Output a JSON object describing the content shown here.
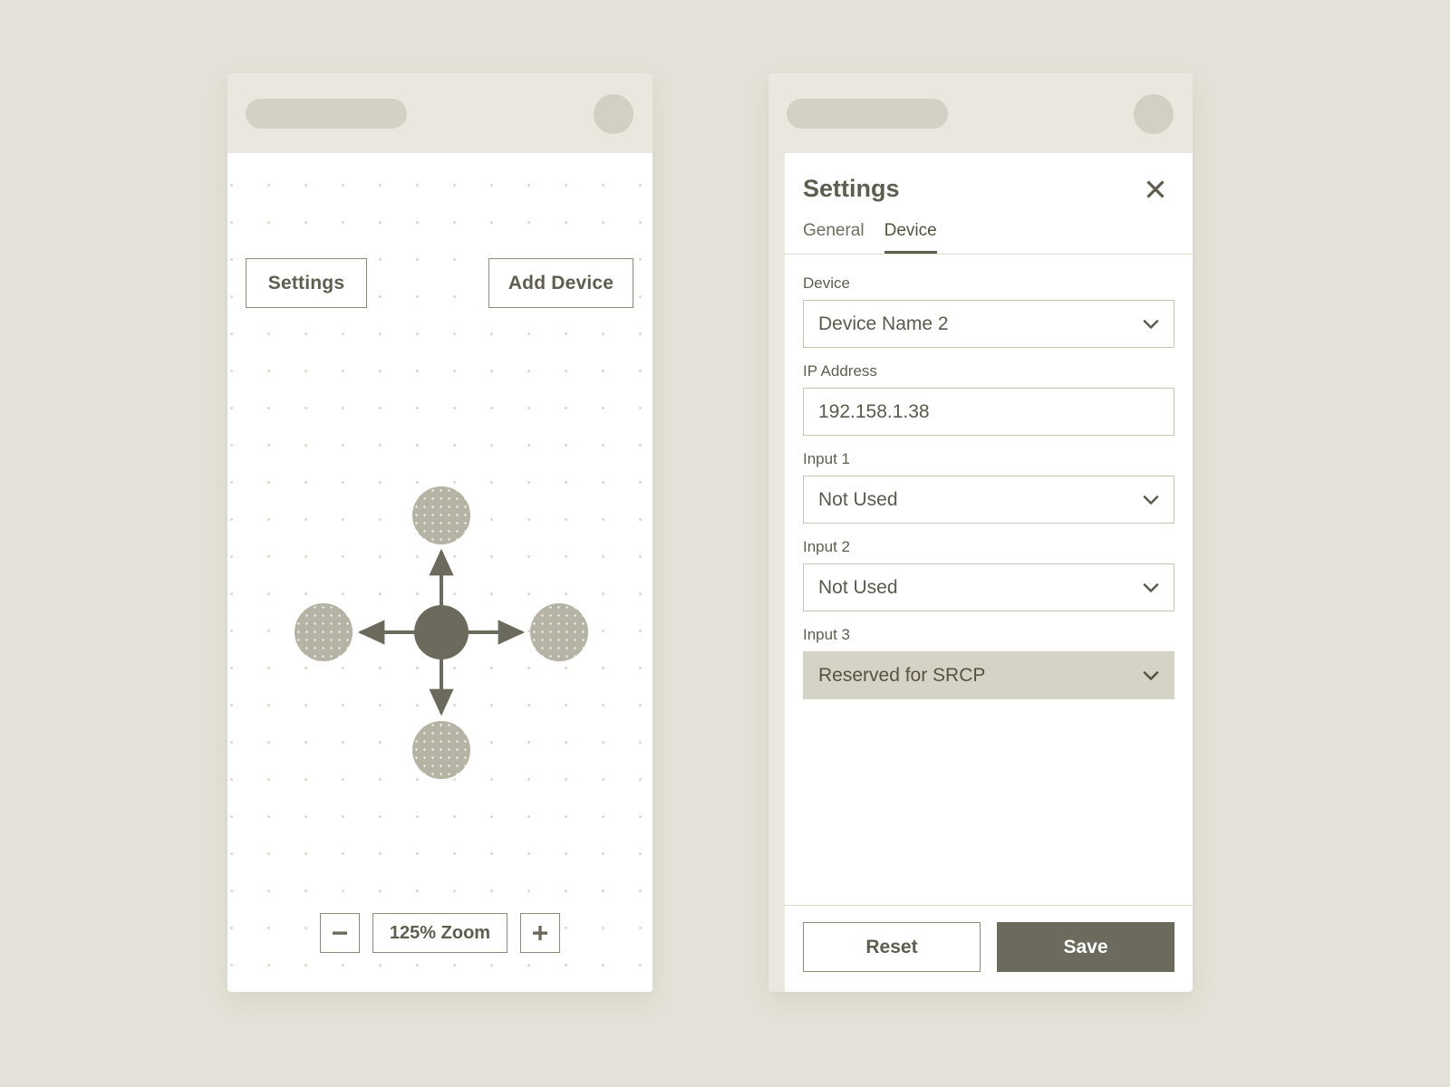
{
  "canvas_screen": {
    "toolbar": {
      "settings_label": "Settings",
      "add_device_label": "Add Device"
    },
    "zoom_controls": {
      "zoom_out_icon": "minus-icon",
      "zoom_level": "125% Zoom",
      "zoom_in_icon": "plus-icon"
    },
    "diagram": {
      "center_node_color": "#6b6a5c",
      "satellite_node_color": "#b5b3a4",
      "arrow_color": "#6b6a5c",
      "nodes": [
        {
          "id": "center",
          "role": "selected-device"
        },
        {
          "id": "top",
          "role": "device"
        },
        {
          "id": "right",
          "role": "device"
        },
        {
          "id": "bottom",
          "role": "device"
        },
        {
          "id": "left",
          "role": "device"
        }
      ],
      "arrows": [
        "up",
        "right",
        "down",
        "left"
      ]
    }
  },
  "settings_screen": {
    "title": "Settings",
    "close_icon": "close-icon",
    "tabs": [
      {
        "label": "General",
        "active": false
      },
      {
        "label": "Device",
        "active": true
      }
    ],
    "fields": [
      {
        "label": "Device",
        "type": "select",
        "value": "Device Name 2",
        "disabled": false,
        "icon": "chevron-down-icon"
      },
      {
        "label": "IP Address",
        "type": "text",
        "value": "192.158.1.38",
        "disabled": false,
        "icon": ""
      },
      {
        "label": "Input 1",
        "type": "select",
        "value": "Not Used",
        "disabled": false,
        "icon": "chevron-down-icon"
      },
      {
        "label": "Input 2",
        "type": "select",
        "value": "Not Used",
        "disabled": false,
        "icon": "chevron-down-icon"
      },
      {
        "label": "Input 3",
        "type": "select",
        "value": "Reserved for SRCP",
        "disabled": true,
        "icon": "chevron-down-icon"
      }
    ],
    "footer": {
      "reset_label": "Reset",
      "save_label": "Save"
    }
  },
  "theme": {
    "page_background": "#e4e2d8",
    "frame_background": "#eae8de",
    "surface": "#ffffff",
    "accent": "#6b6a5c",
    "text": "#5f5d4f",
    "border": "#8d8a78",
    "disabled_fill": "#d5d2c6"
  }
}
